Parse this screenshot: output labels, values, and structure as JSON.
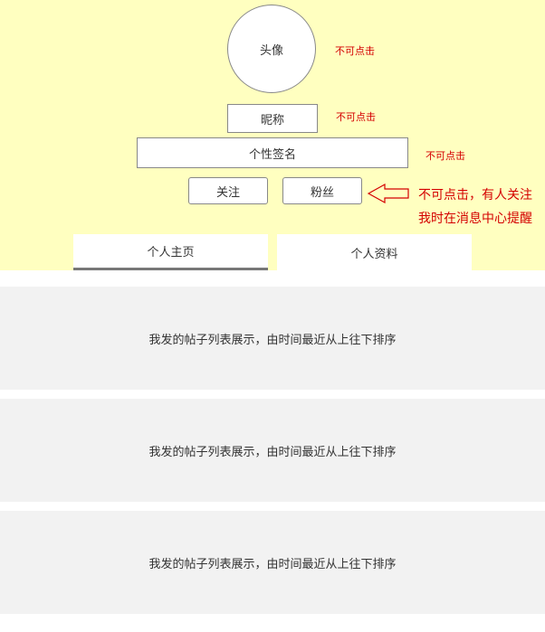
{
  "profile": {
    "avatar_label": "头像",
    "nickname": "昵称",
    "signature": "个性签名",
    "follow_label": "关注",
    "fans_label": "粉丝"
  },
  "annotations": {
    "avatar_note": "不可点击",
    "nickname_note": "不可点击",
    "signature_note": "不可点击",
    "fans_note_line1": "不可点击，有人关注",
    "fans_note_line2": "我时在消息中心提醒"
  },
  "tabs": [
    {
      "label": "个人主页",
      "active": true
    },
    {
      "label": "个人资料",
      "active": false
    }
  ],
  "posts": [
    {
      "text": "我发的帖子列表展示，由时间最近从上往下排序"
    },
    {
      "text": "我发的帖子列表展示，由时间最近从上往下排序"
    },
    {
      "text": "我发的帖子列表展示，由时间最近从上往下排序"
    }
  ],
  "colors": {
    "header_bg": "#ffffc0",
    "annotation": "#d40000",
    "post_bg": "#f2f2f2"
  }
}
